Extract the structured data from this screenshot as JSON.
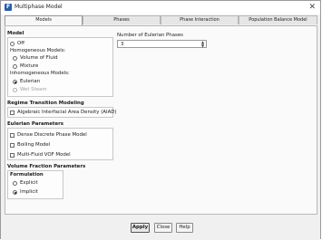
{
  "window": {
    "title": "Multiphase Model"
  },
  "tabs": [
    {
      "label": "Models"
    },
    {
      "label": "Phases"
    },
    {
      "label": "Phase Interaction"
    },
    {
      "label": "Population Balance Model"
    }
  ],
  "model": {
    "heading": "Model",
    "off": "Off",
    "homogeneous_label": "Homogeneous Models:",
    "volume_of_fluid": "Volume of Fluid",
    "mixture": "Mixture",
    "inhomogeneous_label": "Inhomogeneous Models:",
    "eulerian": "Eulerian",
    "wet_steam": "Wet Steam",
    "selected": "Eulerian"
  },
  "eulerian_phases": {
    "label": "Number of Eulerian Phases",
    "value": "3"
  },
  "regime": {
    "heading": "Regime Transition Modeling",
    "aiad": "Algebraic Interfacial Area Density (AIAD)"
  },
  "eulerian_params": {
    "heading": "Eulerian Parameters",
    "dense_dpm": "Dense Discrete Phase Model",
    "boiling": "Boiling Model",
    "multi_fluid_vof": "Multi-Fluid VOF Model"
  },
  "vf_params": {
    "heading": "Volume Fraction Parameters",
    "formulation": "Formulation",
    "explicit": "Explicit",
    "implicit": "Implicit",
    "selected": "Implicit"
  },
  "buttons": {
    "apply": "Apply",
    "close": "Close",
    "help": "Help"
  }
}
